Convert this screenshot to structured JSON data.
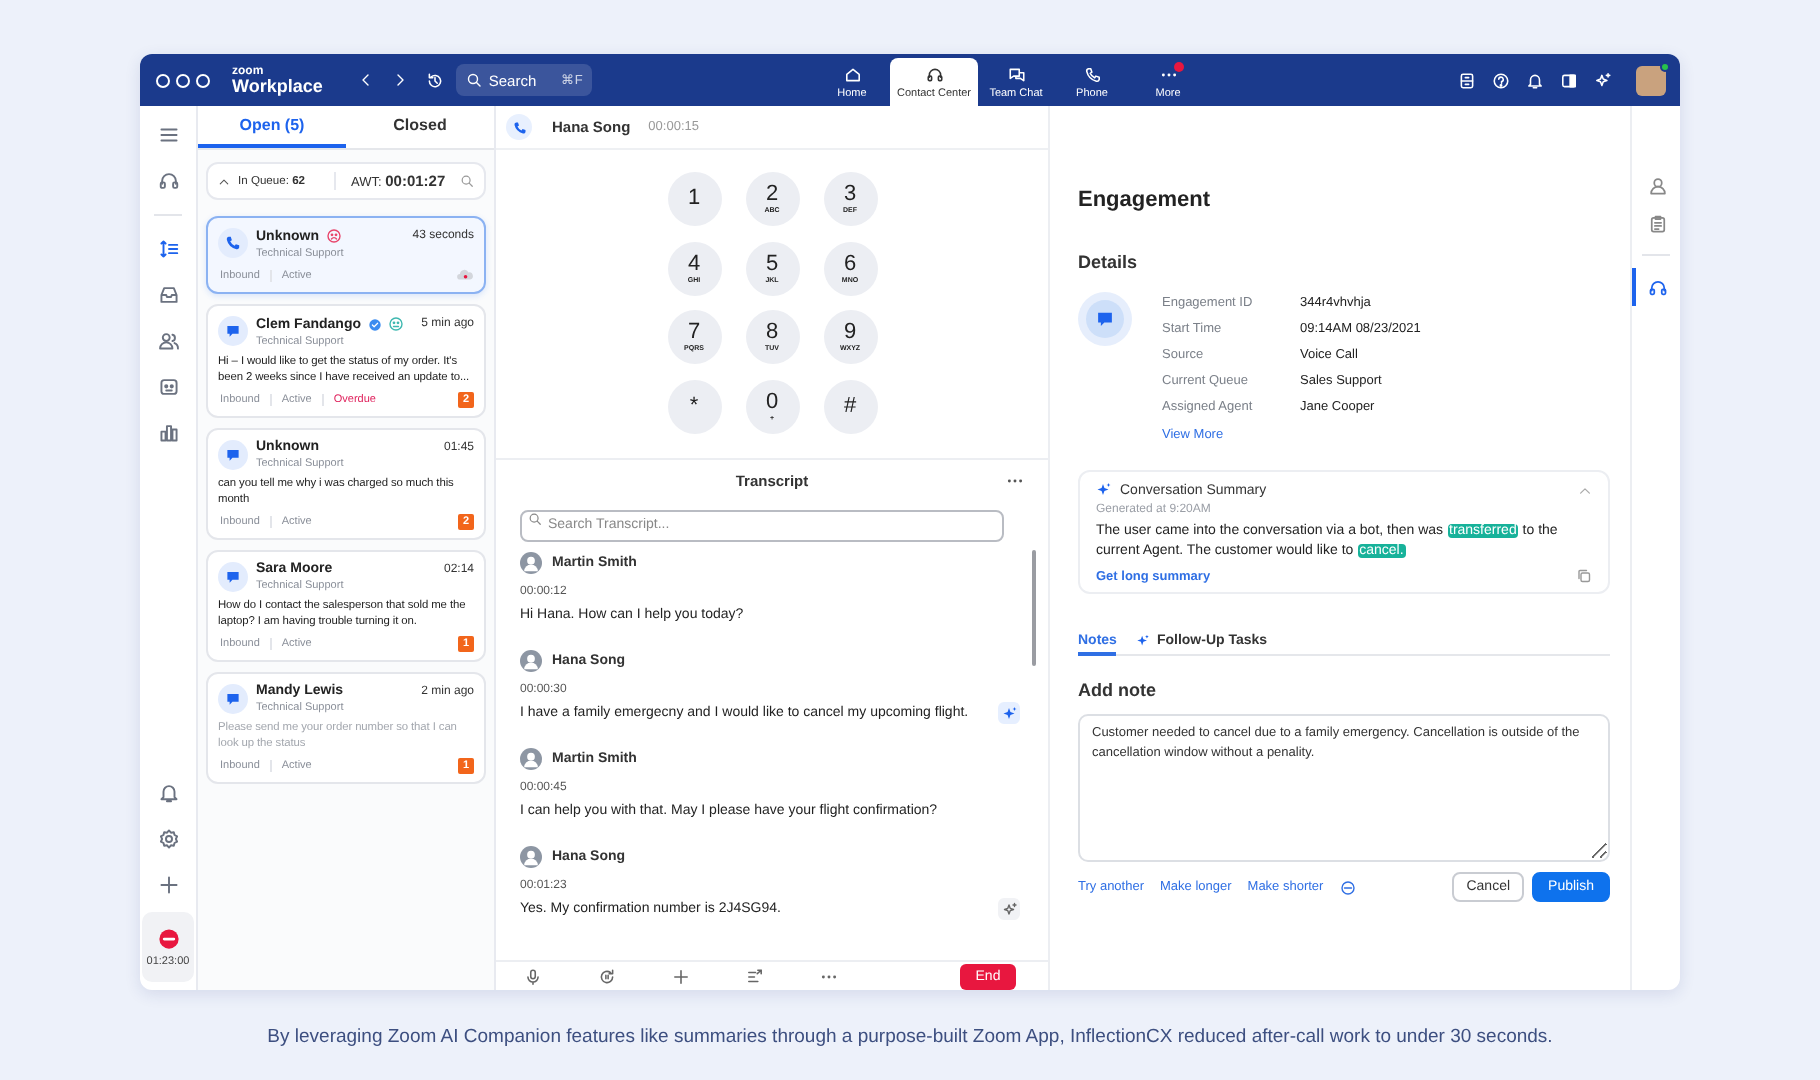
{
  "logo": {
    "brand": "zoom",
    "product": "Workplace"
  },
  "search": {
    "placeholder": "Search",
    "shortcut": "⌘F"
  },
  "nav_tabs": [
    {
      "label": "Home",
      "selected": false,
      "notification": false
    },
    {
      "label": "Contact Center",
      "selected": true,
      "notification": false
    },
    {
      "label": "Team Chat",
      "selected": false,
      "notification": false
    },
    {
      "label": "Phone",
      "selected": false,
      "notification": false
    },
    {
      "label": "More",
      "selected": false,
      "notification": true
    }
  ],
  "user": {
    "online": true
  },
  "left_rail": {
    "items": [
      {
        "selected": false
      },
      {
        "selected": false
      },
      {
        "selected": true
      },
      {
        "selected": false
      },
      {
        "selected": false
      },
      {
        "selected": false
      },
      {
        "selected": false
      }
    ],
    "status_time": "01:23:00"
  },
  "conversations": {
    "tabs": [
      {
        "label": "Open (5)",
        "selected": true
      },
      {
        "label": "Closed",
        "selected": false
      }
    ],
    "queue": {
      "in_queue": "In Queue: **62**",
      "awt": "AWT: **00:01:27**"
    },
    "items": [
      {
        "kind": "phone",
        "name": "Unknown",
        "sentiment": {
          "kind": "negative"
        },
        "verified": false,
        "time": "43 seconds",
        "queue": "Technical Support",
        "tags": [
          {
            "label": "Inbound",
            "kind": "normal"
          },
          {
            "label": "Active",
            "kind": "normal"
          }
        ],
        "recording": true,
        "selected": true
      },
      {
        "kind": "chat",
        "name": "Clem Fandango",
        "sentiment": {
          "kind": "neutral"
        },
        "verified": true,
        "time": "5 min ago",
        "queue": "Technical Support",
        "message": "Hi – I would like to get the status of my order. It's been 2 weeks since I have received an update to...",
        "muted": false,
        "tags": [
          {
            "label": "Inbound",
            "kind": "normal"
          },
          {
            "label": "Active",
            "kind": "normal"
          },
          {
            "label": "Overdue",
            "kind": "overdue"
          }
        ],
        "count": "2",
        "recording": false,
        "selected": false
      },
      {
        "kind": "chat",
        "name": "Unknown",
        "verified": false,
        "time": "01:45",
        "queue": "Technical Support",
        "message": "can you tell me why i was charged so much this month",
        "muted": false,
        "tags": [
          {
            "label": "Inbound",
            "kind": "normal"
          },
          {
            "label": "Active",
            "kind": "normal"
          }
        ],
        "count": "2",
        "recording": false,
        "selected": false
      },
      {
        "kind": "chat",
        "name": "Sara Moore",
        "verified": false,
        "time": "02:14",
        "queue": "Technical Support",
        "message": "How do I contact the salesperson that sold me the laptop? I am having trouble turning it on.",
        "muted": false,
        "tags": [
          {
            "label": "Inbound",
            "kind": "normal"
          },
          {
            "label": "Active",
            "kind": "normal"
          }
        ],
        "count": "1",
        "recording": false,
        "selected": false
      },
      {
        "kind": "chat",
        "name": "Mandy Lewis",
        "verified": false,
        "time": "2 min ago",
        "queue": "Technical Support",
        "message": "Please send me your order number so that I can look up the status",
        "muted": true,
        "tags": [
          {
            "label": "Inbound",
            "kind": "normal"
          },
          {
            "label": "Active",
            "kind": "normal"
          }
        ],
        "count": "1",
        "recording": false,
        "selected": false
      }
    ]
  },
  "call": {
    "caller": "Hana Song",
    "duration": "00:00:15"
  },
  "keypad": [
    {
      "digit": "1"
    },
    {
      "digit": "2",
      "letters": "ABC"
    },
    {
      "digit": "3",
      "letters": "DEF"
    },
    {
      "digit": "4",
      "letters": "GHI"
    },
    {
      "digit": "5",
      "letters": "JKL"
    },
    {
      "digit": "6",
      "letters": "MNO"
    },
    {
      "digit": "7",
      "letters": "PQRS"
    },
    {
      "digit": "8",
      "letters": "TUV"
    },
    {
      "digit": "9",
      "letters": "WXYZ"
    },
    {
      "digit": "*"
    },
    {
      "digit": "0",
      "letters": "+"
    },
    {
      "digit": "#"
    }
  ],
  "transcript": {
    "title": "Transcript",
    "search_placeholder": "Search Transcript...",
    "entries": [
      {
        "speaker": "Martin Smith",
        "time": "00:00:12",
        "text": "Hi Hana. How can I help you today?"
      },
      {
        "speaker": "Hana Song",
        "time": "00:00:30",
        "text": "I have a family emergecny and I would like to cancel my upcoming flight.",
        "ai_button": {
          "kind": "filled"
        }
      },
      {
        "speaker": "Martin Smith",
        "time": "00:00:45",
        "text": "I can help you with that. May I please have your flight confirmation?"
      },
      {
        "speaker": "Hana Song",
        "time": "00:01:23",
        "text": "Yes. My confirmation number is 2J4SG94.",
        "ai_button": {
          "kind": "outline"
        }
      }
    ]
  },
  "call_controls": {
    "end_label": "End"
  },
  "engagement": {
    "title": "Engagement",
    "details_title": "Details",
    "fields": [
      {
        "label": "Engagement ID",
        "value": "344r4vhvhja"
      },
      {
        "label": "Start Time",
        "value": "09:14AM 08/23/2021"
      },
      {
        "label": "Source",
        "value": "Voice Call"
      },
      {
        "label": "Current Queue",
        "value": "Sales Support"
      },
      {
        "label": "Assigned Agent",
        "value": "Jane Cooper"
      }
    ],
    "view_more": "View More",
    "summary": {
      "title": "Conversation Summary",
      "generated": "Generated at 9:20AM",
      "segments": [
        {
          "text": "The user came into the conversation via a bot, then was ",
          "highlight": false
        },
        {
          "text": "transferred",
          "highlight": true
        },
        {
          "text": " to the current Agent. The customer would like to ",
          "highlight": false
        },
        {
          "text": "cancel.",
          "highlight": true
        }
      ],
      "link": "Get long summary"
    },
    "tabs": [
      {
        "label": "Notes",
        "selected": true
      },
      {
        "label": "Follow-Up Tasks",
        "selected": false
      }
    ],
    "note_title": "Add note",
    "note": "Customer needed to cancel due to a family emergency. Cancellation is outside of the cancellation window without a penality.",
    "ai_actions": [
      "Try another",
      "Make longer",
      "Make shorter"
    ],
    "cancel": "Cancel",
    "publish": "Publish"
  },
  "right_rail": {
    "items": [
      {
        "selected": false
      },
      {
        "selected": false
      },
      {
        "selected": true
      }
    ]
  },
  "caption": "By leveraging Zoom AI Companion features like summaries through a purpose-built Zoom App, InflectionCX reduced after-call work to under 30 seconds."
}
